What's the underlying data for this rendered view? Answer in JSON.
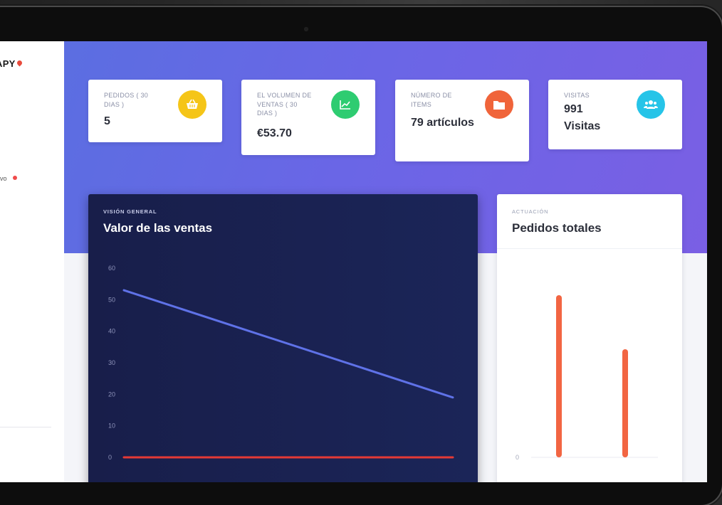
{
  "sidebar": {
    "logo_text": "APY",
    "status_text": "ivo"
  },
  "stat_cards": [
    {
      "label": "PEDIDOS ( 30 DIAS )",
      "value": "5",
      "icon": "basket-icon",
      "icon_color": "#f5c518"
    },
    {
      "label": "EL VOLUMEN DE VENTAS ( 30 DIAS )",
      "value": "€53.70",
      "icon": "chart-line-icon",
      "icon_color": "#2ecc71"
    },
    {
      "label": "NÚMERO DE ITEMS",
      "value": "79 artículos",
      "icon": "folder-icon",
      "icon_color": "#f0643a"
    },
    {
      "label": "VISITAS",
      "value": "991 Visitas",
      "icon": "users-icon",
      "icon_color": "#26c4e8"
    }
  ],
  "overview_panel": {
    "kicker": "VISIÓN GENERAL",
    "title": "Valor de las ventas"
  },
  "performance_panel": {
    "kicker": "ACTUACIÓN",
    "title": "Pedidos totales"
  },
  "colors": {
    "hero_start": "#5b6ee1",
    "hero_end": "#7a5fe4",
    "line_series": "#5f72e8",
    "baseline_series": "#e53935",
    "bar_color": "#f26542"
  },
  "chart_data": [
    {
      "type": "line",
      "title": "Valor de las ventas",
      "ylim": [
        0,
        60
      ],
      "yticks": [
        0,
        10,
        20,
        30,
        40,
        50,
        60
      ],
      "grid": false,
      "series": [
        {
          "values": [
            53,
            19
          ],
          "color": "#5f72e8"
        },
        {
          "values": [
            0,
            0
          ],
          "color": "#e53935"
        }
      ]
    },
    {
      "type": "bar",
      "title": "Pedidos totales",
      "ylim": [
        0,
        70
      ],
      "yticks": [
        0
      ],
      "values": [
        60,
        40
      ],
      "color": "#f26542"
    }
  ]
}
